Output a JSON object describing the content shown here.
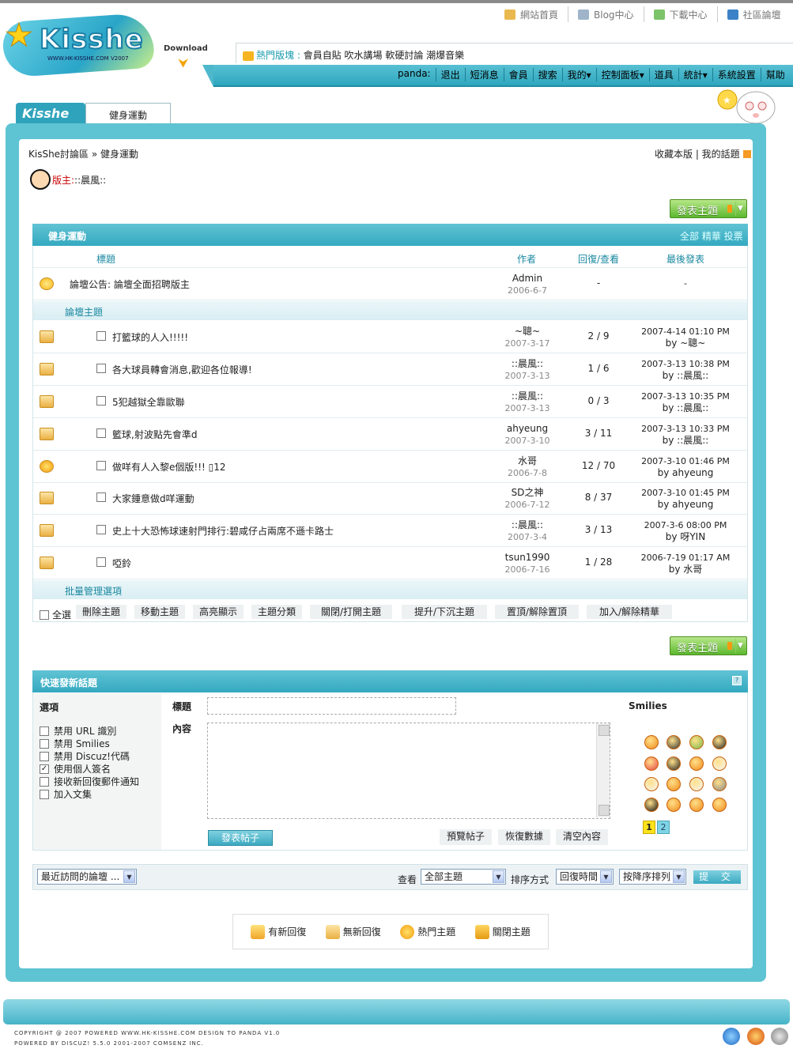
{
  "header": {
    "logo_text": "Kisshe",
    "logo_sub": "WWW.HK-KISSHE.COM V2007",
    "download_label": "Download",
    "topnav": [
      "網站首頁",
      "Blog中心",
      "下載中心",
      "社區論壇"
    ],
    "hot_label": "熱門版塊 :",
    "hot_items": "會員自貼 吹水講場 軟硬討論 潮爆音樂",
    "user_menu": [
      "panda:",
      "退出",
      "短消息",
      "會員",
      "搜索",
      "我的▾",
      "控制面板▾",
      "道具",
      "統計▾",
      "系統設置",
      "幫助"
    ]
  },
  "tabs": {
    "logo_tab": "Kisshe",
    "current": "健身運動"
  },
  "breadcrumb": {
    "text": "KisShe討論區 » 健身運動",
    "right": "收藏本版 | 我的話題"
  },
  "moderator": {
    "label": "版主:",
    "name": "::晨風::"
  },
  "new_topic_label": "發表主題",
  "forum": {
    "name": "健身運動",
    "filters": "全部 精華 投票",
    "columns": {
      "title": "標題",
      "author": "作者",
      "replies": "回復/查看",
      "last": "最後發表"
    },
    "announcement": {
      "title": "論壇公告: 論壇全面招聘版主",
      "author": "Admin",
      "date": "2006-6-7",
      "replies": "-",
      "last": "-"
    },
    "section_label": "論壇主題",
    "threads": [
      {
        "title": "打籃球的人入!!!!!",
        "author": "~聰~",
        "date": "2007-3-17",
        "replies": "2 / 9",
        "last_time": "2007-4-14 01:10 PM",
        "last_by": "by ~聰~"
      },
      {
        "title": "各大球員轉會消息,歡迎各位報導!",
        "author": "::晨風::",
        "date": "2007-3-13",
        "replies": "1 / 6",
        "last_time": "2007-3-13 10:38 PM",
        "last_by": "by ::晨風::"
      },
      {
        "title": "5犯越獄全靠歐聯",
        "author": "::晨風::",
        "date": "2007-3-13",
        "replies": "0 / 3",
        "last_time": "2007-3-13 10:35 PM",
        "last_by": "by ::晨風::"
      },
      {
        "title": "籃球,射波點先會準d",
        "author": "ahyeung",
        "date": "2007-3-10",
        "replies": "3 / 11",
        "last_time": "2007-3-13 10:33 PM",
        "last_by": "by ::晨風::"
      },
      {
        "title": "做咩有人入黎e個版!!! ▯12",
        "author": "水哥",
        "date": "2006-7-8",
        "replies": "12 / 70",
        "last_time": "2007-3-10 01:46 PM",
        "last_by": "by ahyeung"
      },
      {
        "title": "大家鍾意做d咩運動",
        "author": "SD之神",
        "date": "2006-7-12",
        "replies": "8 / 37",
        "last_time": "2007-3-10 01:45 PM",
        "last_by": "by ahyeung"
      },
      {
        "title": "史上十大恐怖球速射門排行:碧咸仔占兩席不遜卡路士",
        "author": "::晨風::",
        "date": "2007-3-4",
        "replies": "3 / 13",
        "last_time": "2007-3-6 08:00 PM",
        "last_by": "by 呀YIN"
      },
      {
        "title": "啞鈴",
        "author": "tsun1990",
        "date": "2006-7-16",
        "replies": "1 / 28",
        "last_time": "2006-7-19 01:17 AM",
        "last_by": "by 水哥"
      }
    ],
    "batch_label": "批量管理選項",
    "select_all": "全選",
    "batch_buttons": [
      "刪除主題",
      "移動主題",
      "高亮顯示",
      "主題分類",
      "關閉/打開主題",
      "提升/下沉主題",
      "置頂/解除置頂",
      "加入/解除精華"
    ]
  },
  "quick_post": {
    "title": "快速發新話題",
    "options_title": "選項",
    "options": [
      {
        "label": "禁用 URL 識別",
        "checked": ""
      },
      {
        "label": "禁用 Smilies",
        "checked": ""
      },
      {
        "label": "禁用 Discuz!代碼",
        "checked": ""
      },
      {
        "label": "使用個人簽名",
        "checked": "✓"
      },
      {
        "label": "接收新回復郵件通知",
        "checked": ""
      },
      {
        "label": "加入文集",
        "checked": ""
      }
    ],
    "title_label": "標題",
    "content_label": "內容",
    "post_button": "發表帖子",
    "preview": "預覽帖子",
    "restore": "恢復數據",
    "clear": "清空內容",
    "smilies_title": "Smilies",
    "pages": [
      "1",
      "2"
    ]
  },
  "filterbar": {
    "recent": "最近訪問的論壇 ...",
    "view_label": "查看",
    "view_value": "全部主題",
    "sort_label": "排序方式",
    "sort_value": "回復時間",
    "order_value": "按降序排列",
    "submit": "提 交"
  },
  "legend": [
    "有新回復",
    "無新回復",
    "熱門主題",
    "關閉主題"
  ],
  "footer": {
    "line1": "COPYRIGHT @ 2007 POWERED WWW.HK-KISSHE.COM DESIGN TO PANDA V1.0",
    "line2": "POWERED BY DISCUZ! 5.5.0  2001-2007 COMSENZ INC."
  },
  "colors": {
    "accent": "#3aaec4",
    "frame": "#5ec3d2",
    "green": "#5cb82e"
  }
}
